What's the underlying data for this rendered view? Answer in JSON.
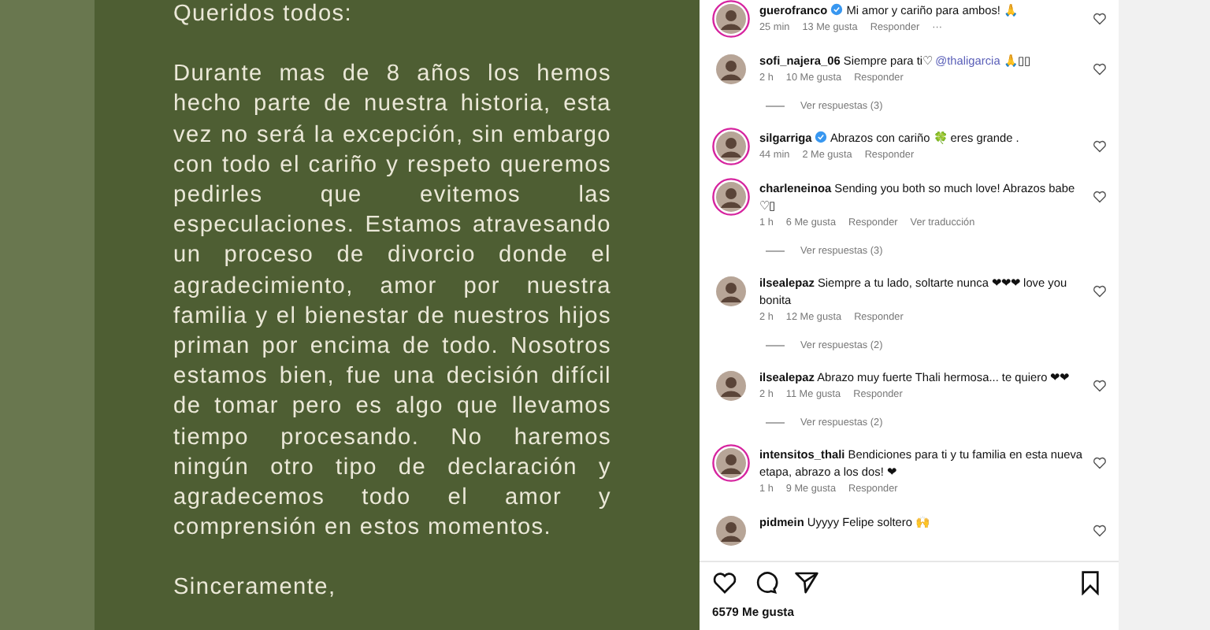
{
  "post_image": {
    "greeting": "Queridos todos:",
    "body": "Durante mas de 8 años los hemos hecho parte de nuestra historia, esta vez no será la excepción, sin embargo con todo el cariño y respeto queremos pedirles que evitemos las especulaciones. Estamos atravesando un proceso de divorcio donde el agradecimiento, amor por nuestra familia y el bienestar de nuestros hijos priman por encima de todo. Nosotros estamos bien, fue una decisión difícil de tomar pero es algo que llevamos tiempo procesando. No haremos ningún otro tipo de declaración y agradecemos todo el amor y comprensión en estos momentos.",
    "closing": "Sinceramente,"
  },
  "comments": [
    {
      "user": "guerofranco",
      "verified": true,
      "ring": true,
      "text": "Mi amor y cariño para ambos! 🙏",
      "time": "25 min",
      "likes": "13 Me gusta",
      "reply": "Responder",
      "more": "···"
    },
    {
      "user": "sofi_najera_06",
      "verified": false,
      "ring": false,
      "text": "Siempre para ti♡",
      "mention": "@thaligarcia",
      "text_after": "🙏▯▯",
      "time": "2 h",
      "likes": "10 Me gusta",
      "reply": "Responder",
      "replies": "Ver respuestas (3)"
    },
    {
      "user": "silgarriga",
      "verified": true,
      "ring": true,
      "text": "Abrazos con cariño 🍀 eres grande .",
      "time": "44 min",
      "likes": "2 Me gusta",
      "reply": "Responder"
    },
    {
      "user": "charleneinoa",
      "verified": false,
      "ring": true,
      "text": "Sending you both so much love! Abrazos babe ♡▯",
      "time": "1 h",
      "likes": "6 Me gusta",
      "reply": "Responder",
      "translate": "Ver traducción",
      "replies": "Ver respuestas (3)"
    },
    {
      "user": "ilsealepaz",
      "verified": false,
      "ring": false,
      "text": "Siempre a tu lado, soltarte nunca ❤❤❤ love you bonita",
      "time": "2 h",
      "likes": "12 Me gusta",
      "reply": "Responder",
      "replies": "Ver respuestas (2)"
    },
    {
      "user": "ilsealepaz",
      "verified": false,
      "ring": false,
      "text": "Abrazo muy fuerte Thali hermosa... te quiero ❤❤",
      "time": "2 h",
      "likes": "11 Me gusta",
      "reply": "Responder",
      "replies": "Ver respuestas (2)"
    },
    {
      "user": "intensitos_thali",
      "verified": false,
      "ring": true,
      "text": "Bendiciones para ti y tu familia en esta nueva etapa, abrazo a los dos! ❤",
      "time": "1 h",
      "likes": "9 Me gusta",
      "reply": "Responder"
    },
    {
      "user": "pidmein",
      "verified": false,
      "ring": false,
      "text": "Uyyyy Felipe soltero 🙌"
    }
  ],
  "likes_count": "6579 Me gusta"
}
